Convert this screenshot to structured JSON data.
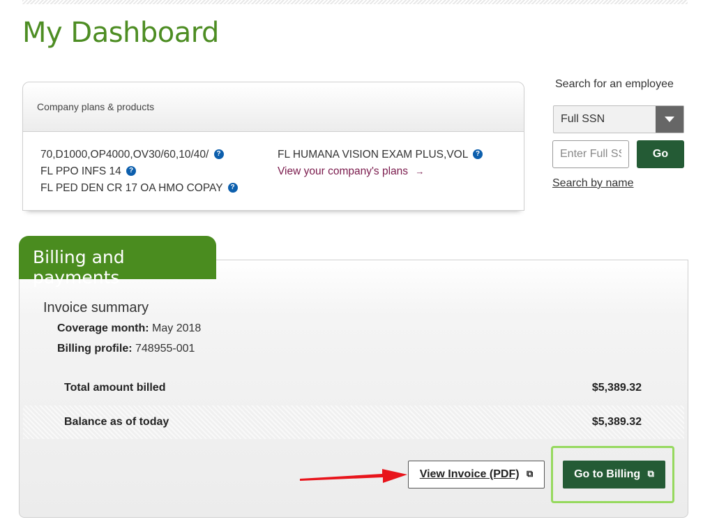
{
  "page": {
    "title": "My Dashboard"
  },
  "plans": {
    "header": "Company plans & products",
    "left_items": [
      "70,D1000,OP4000,OV30/60,10/40/",
      "FL PPO INFS 14",
      "FL PED DEN CR 17 OA HMO COPAY"
    ],
    "right_items": [
      "FL HUMANA VISION EXAM PLUS,VOL"
    ],
    "view_plans_link": "View your company's plans",
    "help_icon_glyph": "?",
    "arrow_glyph": "→"
  },
  "search": {
    "label": "Search for an employee",
    "select_value": "Full SSN",
    "input_placeholder": "Enter Full SSN",
    "go_label": "Go",
    "by_name_link": "Search by name"
  },
  "billing": {
    "tab_label": "Billing and payments",
    "summary_title": "Invoice summary",
    "coverage_month_label": "Coverage month:",
    "coverage_month_value": "May 2018",
    "billing_profile_label": "Billing profile:",
    "billing_profile_value": "748955-001",
    "total_billed_label": "Total amount billed",
    "total_billed_value": "$5,389.32",
    "balance_label": "Balance as of today",
    "balance_value": "$5,389.32",
    "view_invoice_label": "View Invoice (PDF)",
    "go_billing_label": "Go to Billing",
    "external_link_glyph": "⧉"
  },
  "colors": {
    "brand_green": "#4d8d23",
    "dark_green": "#245b35",
    "link_maroon": "#7a1a4c",
    "help_blue": "#0d5fad",
    "highlight": "#96d95e",
    "annotation_red": "#e8141b"
  }
}
